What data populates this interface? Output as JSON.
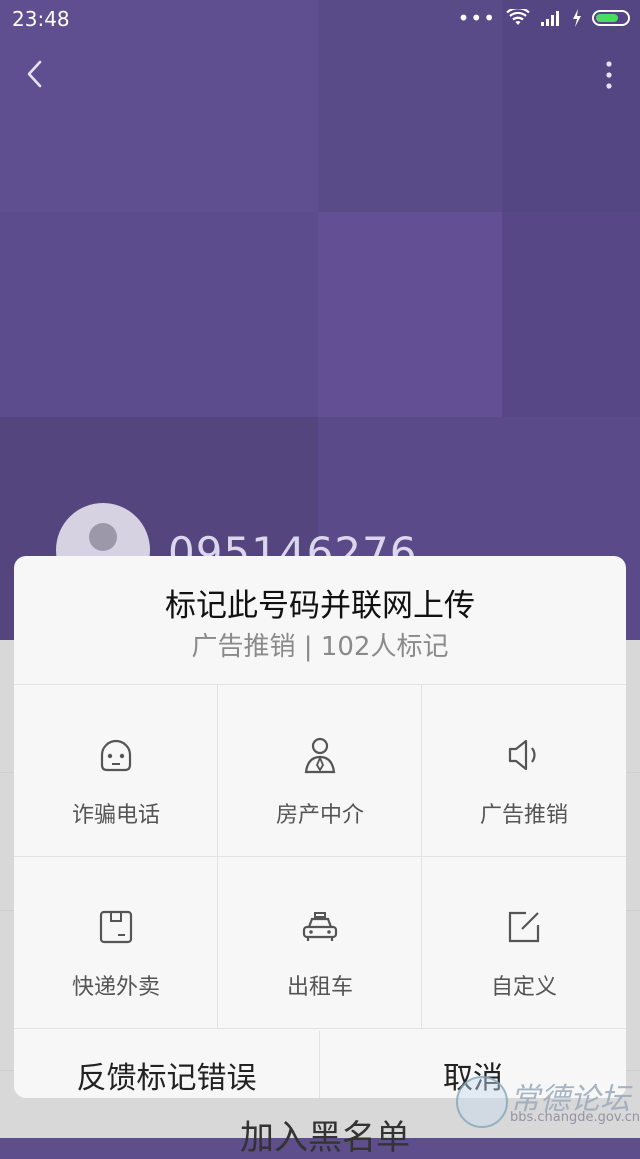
{
  "status_bar": {
    "time": "23:48"
  },
  "contact": {
    "number": "095146276"
  },
  "dialog": {
    "title": "标记此号码并联网上传",
    "subtitle": "广告推销 | 102人标记",
    "options": [
      {
        "label": "诈骗电话",
        "icon": "fraud-mask-icon"
      },
      {
        "label": "房产中介",
        "icon": "agent-person-icon"
      },
      {
        "label": "广告推销",
        "icon": "speaker-icon"
      },
      {
        "label": "快递外卖",
        "icon": "package-icon"
      },
      {
        "label": "出租车",
        "icon": "taxi-icon"
      },
      {
        "label": "自定义",
        "icon": "edit-icon"
      }
    ],
    "feedback_label": "反馈标记错误",
    "cancel_label": "取消"
  },
  "background_peek": {
    "text": "加入黑名单"
  },
  "watermark": {
    "brand": "常德论坛",
    "url": "bbs.changde.gov.cn"
  },
  "colors": {
    "header": "#5a4a8a",
    "battery": "#4cd964",
    "dialog": "#f7f7f7"
  }
}
